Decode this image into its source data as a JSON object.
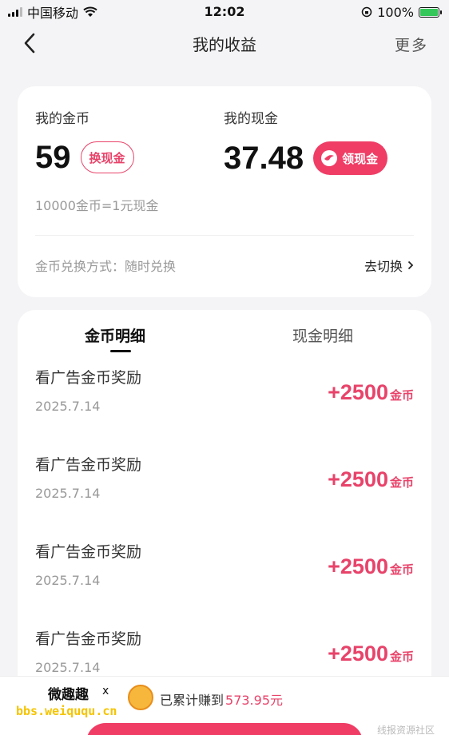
{
  "status_bar": {
    "carrier": "中国移动",
    "time": "12:02",
    "battery": "100%"
  },
  "nav": {
    "title": "我的收益",
    "more": "更多"
  },
  "summary": {
    "gold_label": "我的金币",
    "gold_amount": "59",
    "exchange_button": "换现金",
    "cash_label": "我的现金",
    "cash_amount": "37.48",
    "withdraw_button": "领现金",
    "rate_text": "10000金币=1元现金",
    "method_text": "金币兑换方式：随时兑换",
    "switch_text": "去切换"
  },
  "tabs": [
    {
      "label": "金币明细",
      "active": true
    },
    {
      "label": "现金明细",
      "active": false
    }
  ],
  "records": [
    {
      "title": "看广告金币奖励",
      "date": "2025.7.14",
      "amount": "+2500",
      "unit": "金币"
    },
    {
      "title": "看广告金币奖励",
      "date": "2025.7.14",
      "amount": "+2500",
      "unit": "金币"
    },
    {
      "title": "看广告金币奖励",
      "date": "2025.7.14",
      "amount": "+2500",
      "unit": "金币"
    },
    {
      "title": "看广告金币奖励",
      "date": "2025.7.14",
      "amount": "+2500",
      "unit": "金币"
    }
  ],
  "bottom": {
    "total_label": "已累计赚到",
    "total_value": "573.95元",
    "watermark_cn": "微趣趣",
    "watermark_x": "x",
    "watermark_url": "bbs.weiququ.cn",
    "watermark_right": "线报资源社区"
  },
  "colors": {
    "accent": "#ef3d66",
    "accent_text": "#e8436a",
    "background": "#f4f4f6"
  }
}
